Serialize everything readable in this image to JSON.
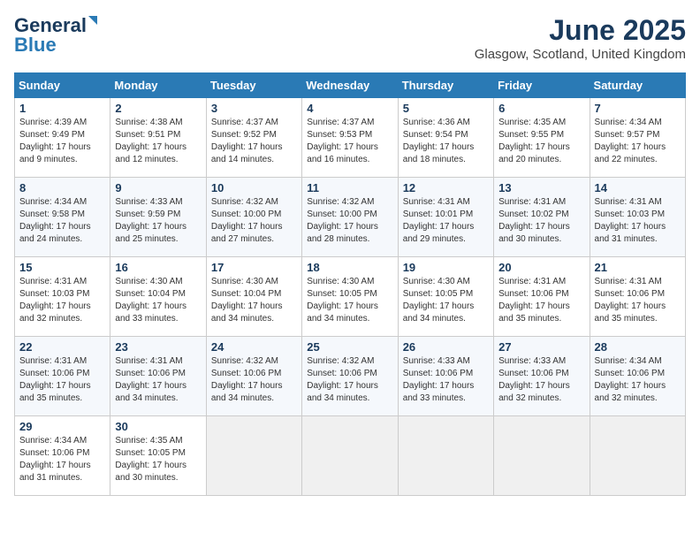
{
  "header": {
    "logo_line1": "General",
    "logo_line2": "Blue",
    "month_title": "June 2025",
    "location": "Glasgow, Scotland, United Kingdom"
  },
  "weekdays": [
    "Sunday",
    "Monday",
    "Tuesday",
    "Wednesday",
    "Thursday",
    "Friday",
    "Saturday"
  ],
  "weeks": [
    [
      {
        "day": "1",
        "sunrise": "Sunrise: 4:39 AM",
        "sunset": "Sunset: 9:49 PM",
        "daylight": "Daylight: 17 hours and 9 minutes."
      },
      {
        "day": "2",
        "sunrise": "Sunrise: 4:38 AM",
        "sunset": "Sunset: 9:51 PM",
        "daylight": "Daylight: 17 hours and 12 minutes."
      },
      {
        "day": "3",
        "sunrise": "Sunrise: 4:37 AM",
        "sunset": "Sunset: 9:52 PM",
        "daylight": "Daylight: 17 hours and 14 minutes."
      },
      {
        "day": "4",
        "sunrise": "Sunrise: 4:37 AM",
        "sunset": "Sunset: 9:53 PM",
        "daylight": "Daylight: 17 hours and 16 minutes."
      },
      {
        "day": "5",
        "sunrise": "Sunrise: 4:36 AM",
        "sunset": "Sunset: 9:54 PM",
        "daylight": "Daylight: 17 hours and 18 minutes."
      },
      {
        "day": "6",
        "sunrise": "Sunrise: 4:35 AM",
        "sunset": "Sunset: 9:55 PM",
        "daylight": "Daylight: 17 hours and 20 minutes."
      },
      {
        "day": "7",
        "sunrise": "Sunrise: 4:34 AM",
        "sunset": "Sunset: 9:57 PM",
        "daylight": "Daylight: 17 hours and 22 minutes."
      }
    ],
    [
      {
        "day": "8",
        "sunrise": "Sunrise: 4:34 AM",
        "sunset": "Sunset: 9:58 PM",
        "daylight": "Daylight: 17 hours and 24 minutes."
      },
      {
        "day": "9",
        "sunrise": "Sunrise: 4:33 AM",
        "sunset": "Sunset: 9:59 PM",
        "daylight": "Daylight: 17 hours and 25 minutes."
      },
      {
        "day": "10",
        "sunrise": "Sunrise: 4:32 AM",
        "sunset": "Sunset: 10:00 PM",
        "daylight": "Daylight: 17 hours and 27 minutes."
      },
      {
        "day": "11",
        "sunrise": "Sunrise: 4:32 AM",
        "sunset": "Sunset: 10:00 PM",
        "daylight": "Daylight: 17 hours and 28 minutes."
      },
      {
        "day": "12",
        "sunrise": "Sunrise: 4:31 AM",
        "sunset": "Sunset: 10:01 PM",
        "daylight": "Daylight: 17 hours and 29 minutes."
      },
      {
        "day": "13",
        "sunrise": "Sunrise: 4:31 AM",
        "sunset": "Sunset: 10:02 PM",
        "daylight": "Daylight: 17 hours and 30 minutes."
      },
      {
        "day": "14",
        "sunrise": "Sunrise: 4:31 AM",
        "sunset": "Sunset: 10:03 PM",
        "daylight": "Daylight: 17 hours and 31 minutes."
      }
    ],
    [
      {
        "day": "15",
        "sunrise": "Sunrise: 4:31 AM",
        "sunset": "Sunset: 10:03 PM",
        "daylight": "Daylight: 17 hours and 32 minutes."
      },
      {
        "day": "16",
        "sunrise": "Sunrise: 4:30 AM",
        "sunset": "Sunset: 10:04 PM",
        "daylight": "Daylight: 17 hours and 33 minutes."
      },
      {
        "day": "17",
        "sunrise": "Sunrise: 4:30 AM",
        "sunset": "Sunset: 10:04 PM",
        "daylight": "Daylight: 17 hours and 34 minutes."
      },
      {
        "day": "18",
        "sunrise": "Sunrise: 4:30 AM",
        "sunset": "Sunset: 10:05 PM",
        "daylight": "Daylight: 17 hours and 34 minutes."
      },
      {
        "day": "19",
        "sunrise": "Sunrise: 4:30 AM",
        "sunset": "Sunset: 10:05 PM",
        "daylight": "Daylight: 17 hours and 34 minutes."
      },
      {
        "day": "20",
        "sunrise": "Sunrise: 4:31 AM",
        "sunset": "Sunset: 10:06 PM",
        "daylight": "Daylight: 17 hours and 35 minutes."
      },
      {
        "day": "21",
        "sunrise": "Sunrise: 4:31 AM",
        "sunset": "Sunset: 10:06 PM",
        "daylight": "Daylight: 17 hours and 35 minutes."
      }
    ],
    [
      {
        "day": "22",
        "sunrise": "Sunrise: 4:31 AM",
        "sunset": "Sunset: 10:06 PM",
        "daylight": "Daylight: 17 hours and 35 minutes."
      },
      {
        "day": "23",
        "sunrise": "Sunrise: 4:31 AM",
        "sunset": "Sunset: 10:06 PM",
        "daylight": "Daylight: 17 hours and 34 minutes."
      },
      {
        "day": "24",
        "sunrise": "Sunrise: 4:32 AM",
        "sunset": "Sunset: 10:06 PM",
        "daylight": "Daylight: 17 hours and 34 minutes."
      },
      {
        "day": "25",
        "sunrise": "Sunrise: 4:32 AM",
        "sunset": "Sunset: 10:06 PM",
        "daylight": "Daylight: 17 hours and 34 minutes."
      },
      {
        "day": "26",
        "sunrise": "Sunrise: 4:33 AM",
        "sunset": "Sunset: 10:06 PM",
        "daylight": "Daylight: 17 hours and 33 minutes."
      },
      {
        "day": "27",
        "sunrise": "Sunrise: 4:33 AM",
        "sunset": "Sunset: 10:06 PM",
        "daylight": "Daylight: 17 hours and 32 minutes."
      },
      {
        "day": "28",
        "sunrise": "Sunrise: 4:34 AM",
        "sunset": "Sunset: 10:06 PM",
        "daylight": "Daylight: 17 hours and 32 minutes."
      }
    ],
    [
      {
        "day": "29",
        "sunrise": "Sunrise: 4:34 AM",
        "sunset": "Sunset: 10:06 PM",
        "daylight": "Daylight: 17 hours and 31 minutes."
      },
      {
        "day": "30",
        "sunrise": "Sunrise: 4:35 AM",
        "sunset": "Sunset: 10:05 PM",
        "daylight": "Daylight: 17 hours and 30 minutes."
      },
      null,
      null,
      null,
      null,
      null
    ]
  ]
}
